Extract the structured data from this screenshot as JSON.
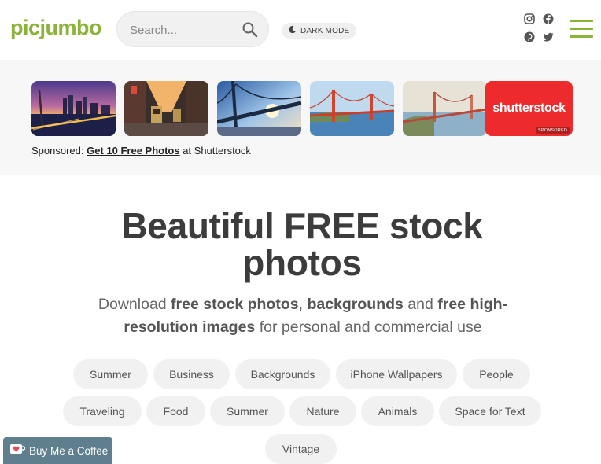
{
  "header": {
    "logo": "picjumbo",
    "search_placeholder": "Search...",
    "dark_mode_label": "DARK MODE",
    "social_icons": [
      "instagram-icon",
      "facebook-icon",
      "pinterest-icon",
      "twitter-icon"
    ],
    "brand_color": "#8bb23a"
  },
  "sponsored": {
    "thumbnails": [
      "san-francisco-skyline-night",
      "cable-car-street",
      "bay-bridge-sunset",
      "golden-gate-bridge-day",
      "golden-gate-bridge-misty"
    ],
    "shutterstock_brand": "shutterstock",
    "shutterstock_tag": "SPONSORED",
    "shutterstock_color": "#ee2b2c",
    "prefix": "Sponsored: ",
    "link": "Get 10 Free Photos",
    "suffix": " at Shutterstock"
  },
  "hero": {
    "title_line1": "Beautiful FREE stock",
    "title_line2": "photos",
    "sub_1": "Download ",
    "sub_b1": "free stock photos",
    "sub_2": ", ",
    "sub_b2": "backgrounds",
    "sub_3": " and ",
    "sub_b3": "free high-resolution images",
    "sub_4": " for personal and commercial use"
  },
  "tags": {
    "row1": [
      "Summer",
      "Business",
      "Backgrounds",
      "iPhone Wallpapers",
      "People"
    ],
    "row2": [
      "Traveling",
      "Food",
      "Summer",
      "Nature",
      "Animals",
      "Space for Text"
    ],
    "row3": [
      "Vintage"
    ]
  },
  "bmc": {
    "label": "Buy Me a Coffee"
  }
}
